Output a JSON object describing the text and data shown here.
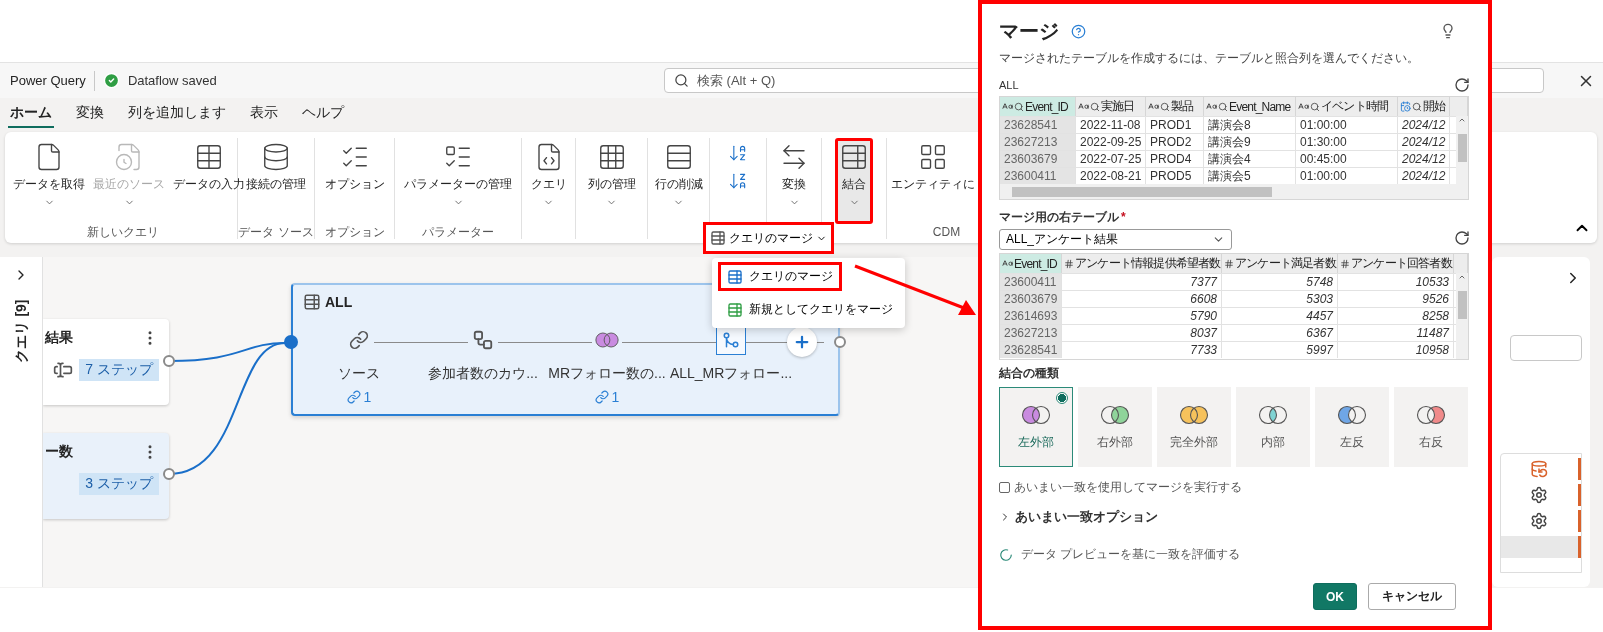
{
  "app_bar": {
    "title": "Power Query",
    "status": "Dataflow saved",
    "search_placeholder": "検索 (Alt + Q)"
  },
  "tabs": [
    {
      "label": "ホーム",
      "selected": true
    },
    {
      "label": "変換",
      "selected": false
    },
    {
      "label": "列を追加します",
      "selected": false
    },
    {
      "label": "表示",
      "selected": false
    },
    {
      "label": "ヘルプ",
      "selected": false
    }
  ],
  "ribbon": {
    "groups": [
      {
        "label": "新しいクエリ",
        "buttons": [
          {
            "kind": "get",
            "label": "データを取得",
            "caret": true,
            "disabled": false,
            "pressed": false,
            "highlighted": false
          },
          {
            "kind": "recent",
            "label": "最近のソース",
            "caret": true,
            "disabled": true,
            "pressed": false,
            "highlighted": false
          },
          {
            "kind": "enter",
            "label": "データの入力",
            "caret": false,
            "disabled": false,
            "pressed": false,
            "highlighted": false
          }
        ]
      },
      {
        "label": "データ ソース",
        "buttons": [
          {
            "kind": "connections",
            "label": "接続の管理",
            "caret": false,
            "disabled": false,
            "pressed": false,
            "highlighted": false
          }
        ]
      },
      {
        "label": "オプション",
        "buttons": [
          {
            "kind": "options",
            "label": "オプション",
            "caret": false,
            "disabled": false,
            "pressed": false,
            "highlighted": false
          }
        ]
      },
      {
        "label": "パラメーター",
        "buttons": [
          {
            "kind": "parameters",
            "label": "パラメーターの管理",
            "caret": true,
            "disabled": false,
            "pressed": false,
            "highlighted": false
          }
        ]
      },
      {
        "buttons": [
          {
            "kind": "query",
            "label": "クエリ",
            "caret": true,
            "disabled": false,
            "pressed": false,
            "highlighted": false
          }
        ]
      },
      {
        "buttons": [
          {
            "kind": "columns",
            "label": "列の管理",
            "caret": true,
            "disabled": false,
            "pressed": false,
            "highlighted": false
          }
        ]
      },
      {
        "buttons": [
          {
            "kind": "rows",
            "label": "行の削減",
            "caret": true,
            "disabled": false,
            "pressed": false,
            "highlighted": false
          }
        ]
      },
      {
        "buttons": [
          {
            "kind": "sort"
          }
        ]
      },
      {
        "buttons": [
          {
            "kind": "transform",
            "label": "変換",
            "caret": true,
            "disabled": false,
            "pressed": false,
            "highlighted": false
          }
        ]
      },
      {
        "buttons": [
          {
            "kind": "combine",
            "label": "結合",
            "caret": true,
            "disabled": false,
            "pressed": true,
            "highlighted": true
          }
        ]
      },
      {
        "label": "CDM",
        "buttons": [
          {
            "kind": "entity",
            "label": "エンティティに",
            "caret": false,
            "disabled": false,
            "pressed": false,
            "highlighted": false
          }
        ]
      }
    ]
  },
  "merge_split_button": {
    "label": "クエリのマージ",
    "highlighted": true
  },
  "merge_menu": {
    "items": [
      {
        "kind": "merge",
        "label": "クエリのマージ",
        "highlighted": true
      },
      {
        "kind": "mergenew",
        "label": "新規としてクエリをマージ",
        "highlighted": false
      }
    ]
  },
  "queries_pane": {
    "title": "クエリ [9]"
  },
  "diagram": {
    "query_cards": [
      {
        "kind": "survey",
        "title": "結果",
        "steps": "7 ステップ",
        "selected": false
      },
      {
        "kind": "count",
        "title": "ー数",
        "steps": "3 ステップ",
        "selected": true
      }
    ],
    "node": {
      "title": "ALL",
      "steps": [
        {
          "kind": "source",
          "label": "ソース",
          "badge": "1",
          "selected": false
        },
        {
          "kind": "group",
          "label": "参加者数のカウ...",
          "selected": false
        },
        {
          "kind": "merge",
          "label": "MRフォロー数の...",
          "badge": "1",
          "selected": false
        },
        {
          "kind": "expand",
          "label": "ALL_MRフォロー...",
          "selected": true
        }
      ]
    }
  },
  "merge_dialog": {
    "title": "マージ",
    "description": "マージされたテーブルを作成するには、テーブルと照合列を選んでください。",
    "left_table": {
      "name": "ALL",
      "columns": [
        {
          "name": "Event_ID",
          "kind": "text",
          "selected": true
        },
        {
          "name": "実施日",
          "kind": "text",
          "selected": false
        },
        {
          "name": "製品",
          "kind": "text",
          "selected": false
        },
        {
          "name": "Event_Name",
          "kind": "text",
          "selected": false
        },
        {
          "name": "イベント時間",
          "kind": "text",
          "selected": false
        },
        {
          "name": "開始",
          "kind": "datetime",
          "selected": false
        }
      ],
      "rows": [
        [
          "23628541",
          "2022-11-08",
          "PROD1",
          "講演会8",
          "01:00:00",
          "2024/12"
        ],
        [
          "23627213",
          "2022-09-25",
          "PROD2",
          "講演会9",
          "01:30:00",
          "2024/12"
        ],
        [
          "23603679",
          "2022-07-25",
          "PROD4",
          "講演会4",
          "00:45:00",
          "2024/12"
        ],
        [
          "23600411",
          "2022-08-21",
          "PROD5",
          "講演会5",
          "01:00:00",
          "2024/12"
        ]
      ]
    },
    "right_table_label": "マージ用の右テーブル",
    "required_mark": "*",
    "right_table_value": "ALL_アンケート結果",
    "right_table": {
      "columns": [
        {
          "name": "Event_ID",
          "kind": "text",
          "selected": true
        },
        {
          "name": "アンケート情報提供希望者数",
          "kind": "number",
          "selected": false
        },
        {
          "name": "アンケート満足者数",
          "kind": "number",
          "selected": false
        },
        {
          "name": "アンケート回答者数",
          "kind": "number",
          "selected": false
        }
      ],
      "rows": [
        [
          "23600411",
          "7377",
          "5748",
          "10533"
        ],
        [
          "23603679",
          "6608",
          "5303",
          "9526"
        ],
        [
          "23614693",
          "5790",
          "4457",
          "8258"
        ],
        [
          "23627213",
          "8037",
          "6367",
          "11487"
        ],
        [
          "23628541",
          "7733",
          "5997",
          "10958"
        ]
      ]
    },
    "join_kind_label": "結合の種類",
    "join_kinds": [
      {
        "kind": "leftouter",
        "label": "左外部",
        "color": "#c98be0",
        "selected": true
      },
      {
        "kind": "rightouter",
        "label": "右外部",
        "color": "#8fd49a",
        "selected": false
      },
      {
        "kind": "fullouter",
        "label": "完全外部",
        "color": "#f6c25c",
        "selected": false
      },
      {
        "kind": "inner",
        "label": "内部",
        "color": "#7fd3d3",
        "selected": false
      },
      {
        "kind": "leftanti",
        "label": "左反",
        "color": "#6fa6e6",
        "selected": false
      },
      {
        "kind": "rightanti",
        "label": "右反",
        "color": "#f08a8a",
        "selected": false
      }
    ],
    "fuzzy_match": {
      "label": "あいまい一致を使用してマージを実行する",
      "checked": false
    },
    "fuzzy_options": {
      "label": "あいまい一致オプション",
      "expanded": false
    },
    "status": "データ プレビューを基に一致を評価する",
    "buttons": [
      {
        "kind": "primary",
        "label": "OK"
      },
      {
        "kind": "secondary",
        "label": "キャンセル"
      }
    ]
  }
}
